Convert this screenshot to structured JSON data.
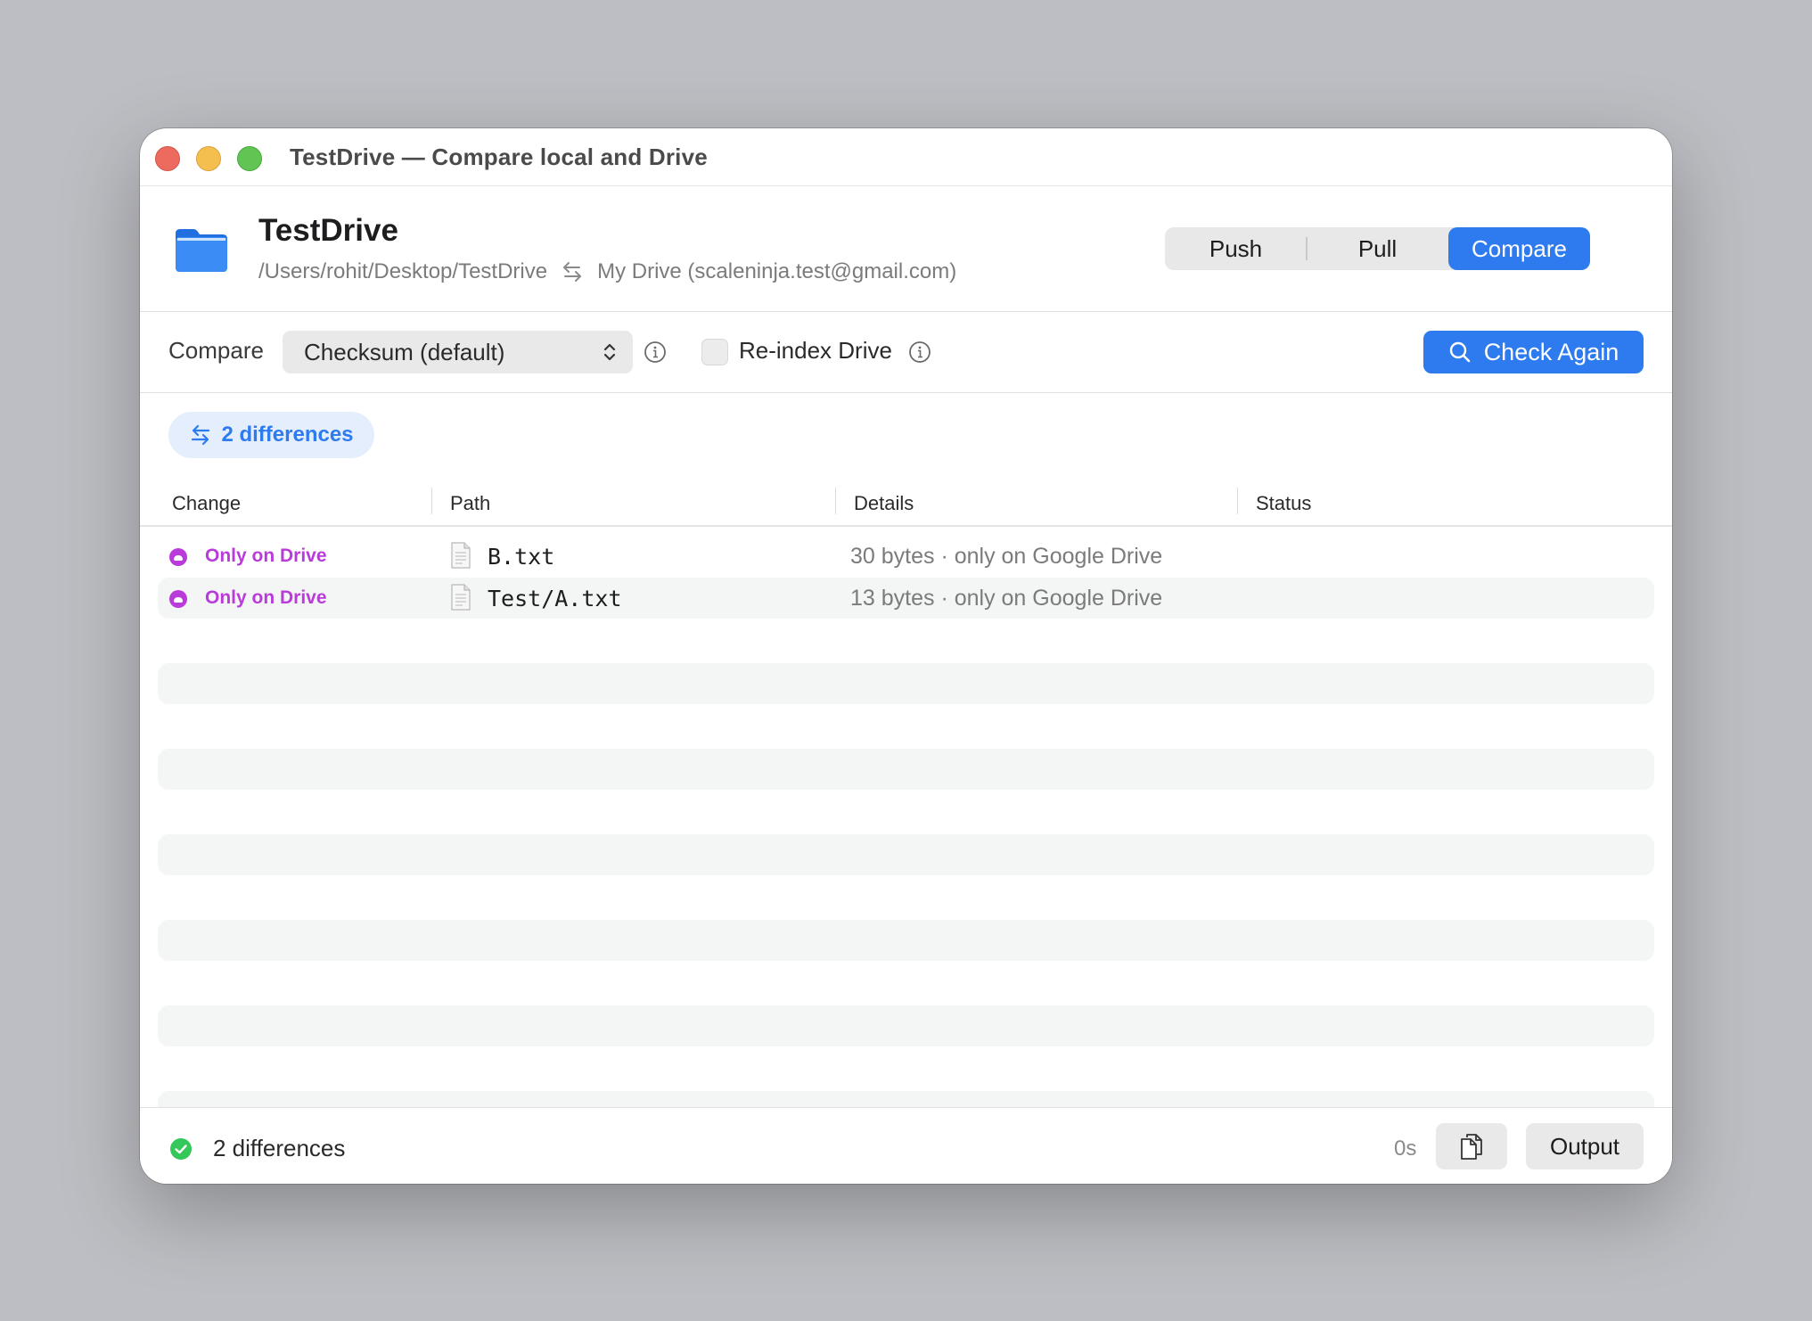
{
  "window": {
    "title": "TestDrive — Compare local and Drive"
  },
  "header": {
    "project_name": "TestDrive",
    "local_path": "/Users/rohit/Desktop/TestDrive",
    "remote": "My Drive (scaleninja.test@gmail.com)",
    "modes": [
      {
        "label": "Push",
        "active": false
      },
      {
        "label": "Pull",
        "active": false
      },
      {
        "label": "Compare",
        "active": true
      }
    ]
  },
  "toolbar": {
    "compare_label": "Compare",
    "compare_method": "Checksum (default)",
    "reindex_label": "Re-index Drive",
    "reindex_checked": false,
    "check_again_label": "Check Again"
  },
  "summary": {
    "pill_label": "2 differences"
  },
  "table": {
    "columns": [
      "Change",
      "Path",
      "Details",
      "Status"
    ],
    "rows": [
      {
        "change": "Only on Drive",
        "path": "B.txt",
        "details": "30 bytes · only on Google Drive",
        "status": ""
      },
      {
        "change": "Only on Drive",
        "path": "Test/A.txt",
        "details": "13 bytes · only on Google Drive",
        "status": ""
      }
    ]
  },
  "footer": {
    "status": "2 differences",
    "elapsed": "0s",
    "output_label": "Output"
  },
  "colors": {
    "accent": "#2e7bf0",
    "only_on_drive": "#b93bd9",
    "success": "#34c759"
  },
  "icons": {
    "folder": "folder-icon",
    "sync": "sync-arrows-icon",
    "info": "info-icon",
    "search": "search-icon",
    "file": "file-icon",
    "cloud": "cloud-icon",
    "check": "checkmark-circle-icon",
    "copy": "copy-icon"
  }
}
